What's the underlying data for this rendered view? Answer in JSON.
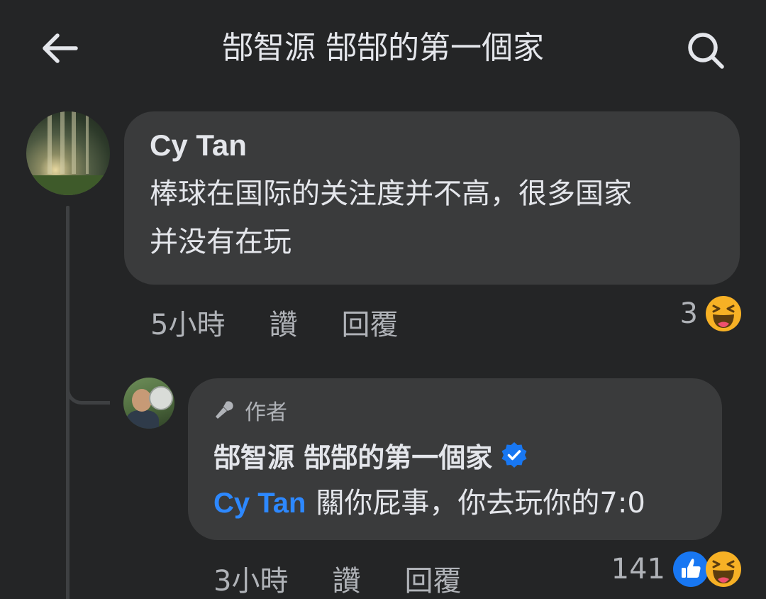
{
  "header": {
    "title": "郜智源 郜郜的第一個家",
    "back_icon": "arrow-left-icon",
    "search_icon": "search-icon"
  },
  "comment": {
    "author": "Cy Tan",
    "text_line1": "棒球在国际的关注度并不高，很多国家",
    "text_line2": "并没有在玩",
    "time": "5小時",
    "like_label": "讚",
    "reply_label": "回覆",
    "reaction_count": "3",
    "reactions": [
      "haha-icon"
    ]
  },
  "reply": {
    "author_badge": "作者",
    "author": "郜智源 郜郜的第一個家",
    "verified": true,
    "mention": "Cy Tan",
    "text": "關你屁事，你去玩你的7:0",
    "time": "3小時",
    "like_label": "讚",
    "reply_label": "回覆",
    "reaction_count": "141",
    "reactions": [
      "like-icon",
      "haha-icon"
    ]
  },
  "colors": {
    "background": "#242526",
    "bubble": "#3a3b3c",
    "text_primary": "#e4e6eb",
    "text_secondary": "#b0b3b8",
    "link": "#2d88ff",
    "verified": "#1877f2"
  }
}
